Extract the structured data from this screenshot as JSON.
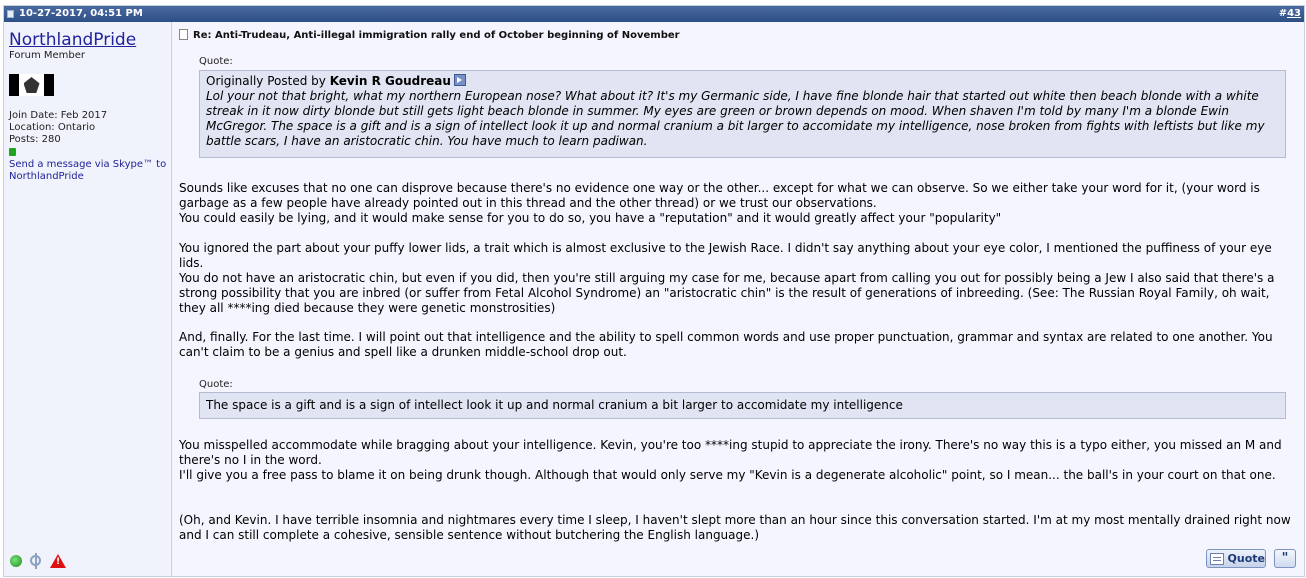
{
  "post": {
    "date": "10-27-2017, 04:51 PM",
    "number_prefix": "#",
    "number": "43"
  },
  "author": {
    "username": "NorthlandPride",
    "title": "Forum Member",
    "join_date": "Join Date: Feb 2017",
    "location": "Location: Ontario",
    "posts": "Posts: 280",
    "skype": "Send a message via Skype™ to NorthlandPride"
  },
  "title": "Re: Anti-Trudeau, Anti-illegal immigration rally end of October beginning of November",
  "quote1": {
    "label": "Quote:",
    "originally_posted_by": "Originally Posted by",
    "author": "Kevin R Goudreau",
    "text": "Lol your not that bright, what my northern European nose? What about it? It's my Germanic side, I have fine blonde hair that started out white then beach blonde with a white streak in it now dirty blonde but still gets light beach blonde in summer. My eyes are green or brown depends on mood. When shaven I'm told by many I'm a blonde Ewin McGregor. The space is a gift and is a sign of intellect look it up and normal cranium a bit larger to accomidate my intelligence, nose broken from fights with leftists but like my battle scars, I have an aristocratic chin. You have much to learn padiwan."
  },
  "body": {
    "p1a": "Sounds like excuses that no one can disprove because there's no evidence one way or the other... except for what we can observe. So we either take your word for it, (your word is garbage as a few people have already pointed out in this thread and the other thread) or we trust our observations.",
    "p1b": "You could easily be lying, and it would make sense for you to do so, you have a \"reputation\" and it would greatly affect your \"popularity\"",
    "p2a": "You ignored the part about your puffy lower lids, a trait which is almost exclusive to the Jewish Race. I didn't say anything about your eye color, I mentioned the puffiness of your eye lids.",
    "p2b": "You do not have an aristocratic chin, but even if you did, then you're still arguing my case for me, because apart from calling you out for possibly being a Jew I also said that there's a strong possibility that you are inbred (or suffer from Fetal Alcohol Syndrome) an \"aristocratic chin\" is the result of generations of inbreeding. (See: The Russian Royal Family, oh wait, they all ****ing died because they were genetic monstrosities)",
    "p3": "And, finally. For the last time. I will point out that intelligence and the ability to spell common words and use proper punctuation, grammar and syntax are related to one another. You can't claim to be a genius and spell like a drunken middle-school drop out.",
    "p4a": "You misspelled accommodate while bragging about your intelligence. Kevin, you're too ****ing stupid to appreciate the irony. There's no way this is a typo either, you missed an M and there's no I in the word.",
    "p4b": "I'll give you a free pass to blame it on being drunk though. Although that would only serve my \"Kevin is a degenerate alcoholic\" point, so I mean... the ball's in your court on that one.",
    "p5": "(Oh, and Kevin. I have terrible insomnia and nightmares every time I sleep, I haven't slept more than an hour since this conversation started. I'm at my most mentally drained right now and I can still complete a cohesive, sensible sentence without butchering the English language.)"
  },
  "quote2": {
    "label": "Quote:",
    "text": "The space is a gift and is a sign of intellect look it up and normal cranium a bit larger to accomidate my intelligence"
  },
  "buttons": {
    "quote": "Quote",
    "multiquote": "\""
  },
  "icons": {
    "online": "online-status-icon",
    "reputation": "reputation-icon",
    "report": "report-post-icon"
  },
  "colors": {
    "header": "#2d4f86",
    "link": "#22229c",
    "quote_bg": "#e1e4f2",
    "online": "#1fa51f",
    "report": "#dd1111"
  }
}
